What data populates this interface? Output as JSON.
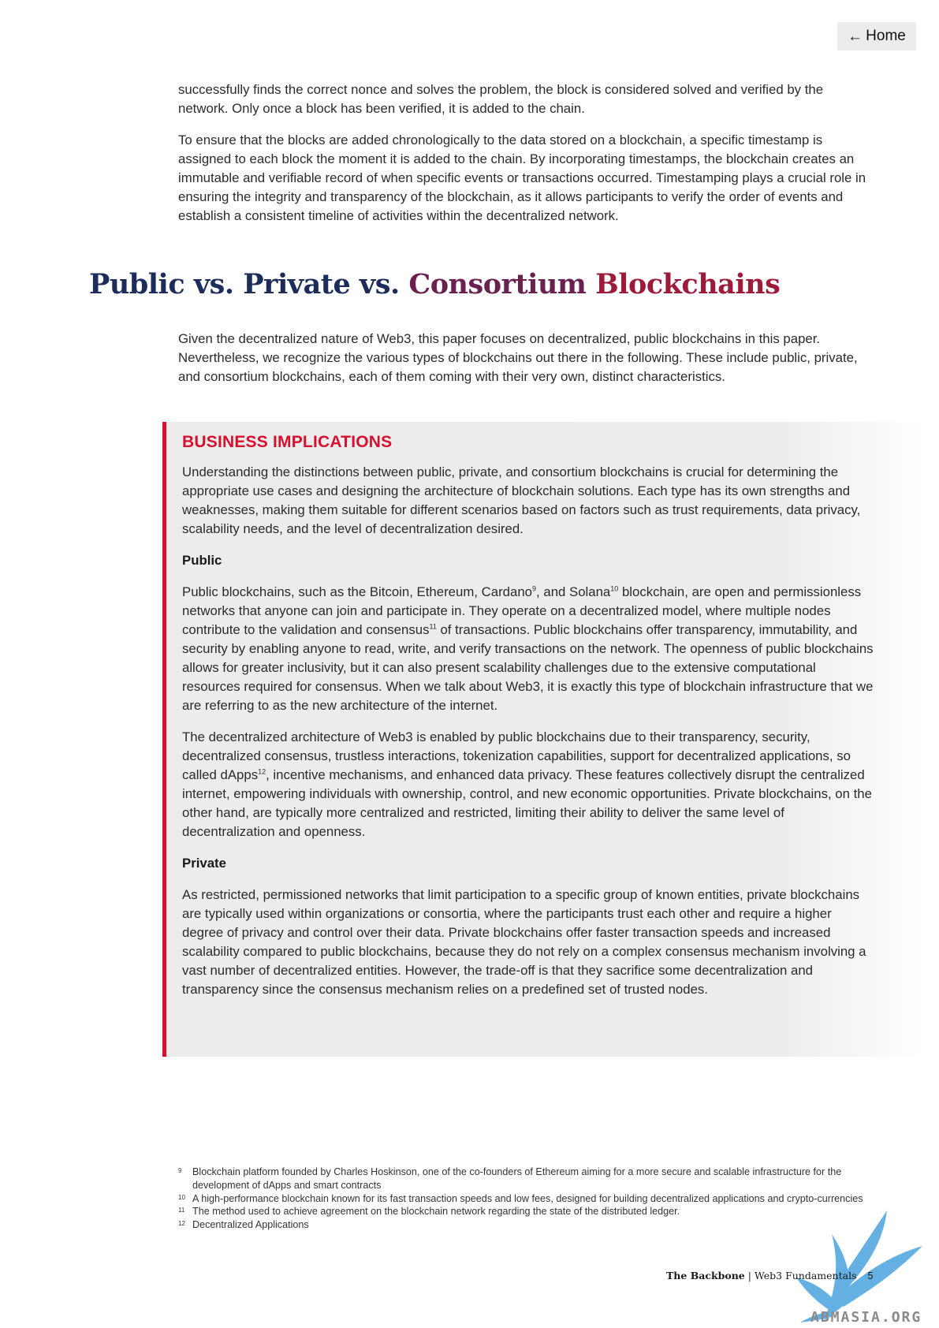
{
  "nav": {
    "home_label": "Home"
  },
  "intro": {
    "p1": "successfully finds the correct nonce and solves the problem, the block is considered solved and verified by the network. Only once a block has been verified, it is added to the chain.",
    "p2": "To ensure that the blocks are added chronologically to the data stored on a blockchain, a specific timestamp is assigned to each block the moment it is added to the chain. By incorporating timestamps, the blockchain creates an immutable and verifiable record of when specific events or transactions occurred. Timestamping plays a crucial role in ensuring the integrity and transparency of the blockchain, as it allows participants to verify the order of events and establish a consistent timeline of activities within the decentralized network."
  },
  "section": {
    "title_part1": "Public vs. Private vs. ",
    "title_part2": "Consortium ",
    "title_part3": "Blockchains",
    "paragraph": "Given the decentralized nature of Web3, this paper focuses on decentralized, public blockchains in this paper. Nevertheless, we recognize the various types of blockchains out there in the following. These include public, private, and consortium blockchains, each of them coming with their very own, distinct characteristics."
  },
  "callout": {
    "title": "BUSINESS IMPLICATIONS",
    "intro": "Understanding the distinctions between public, private, and consortium blockchains is crucial for determining the appropriate use cases and designing the architecture of blockchain solutions. Each type has its own strengths and weaknesses, making them suitable for different scenarios based on factors such as trust requirements, data privacy, scalability needs, and the level of decentralization desired.",
    "public_heading": "Public",
    "public_p1_a": "Public blockchains, such as the Bitcoin, Ethereum, Cardano",
    "public_p1_sup1": "9",
    "public_p1_b": ", and Solana",
    "public_p1_sup2": "10",
    "public_p1_c": " blockchain, are open and permissionless networks that anyone can join and participate in. They operate on a decentralized model, where multiple nodes contribute to the validation and consensus",
    "public_p1_sup3": "11",
    "public_p1_d": " of transactions. Public blockchains offer transparency, immutability, and security by enabling anyone to read, write, and verify transactions on the network. The openness of public blockchains allows for greater inclusivity, but it can also present scalability challenges due to the extensive computational resources required for consensus. When we talk about Web3, it is exactly this type of blockchain infrastructure that we are referring to as the new architecture of the internet.",
    "public_p2_a": "The decentralized architecture of Web3 is enabled by public blockchains due to their transparency, security, decentralized consensus, trustless interactions, tokenization capabilities, support for decentralized applications, so called dApps",
    "public_p2_sup": "12",
    "public_p2_b": ", incentive mechanisms, and enhanced data privacy. These features collectively disrupt the centralized internet, empowering individuals with ownership, control, and new economic opportunities. Private blockchains, on the other hand, are typically more centralized and restricted, limiting their ability to deliver the same level of decentralization and openness.",
    "private_heading": "Private",
    "private_p": "As restricted, permissioned networks that limit participation to a specific group of known entities, private blockchains are typically used within organizations or consortia, where the participants trust each other and require a higher degree of privacy and control over their data. Private blockchains offer faster transaction speeds and increased scalability compared to public blockchains, because they do not rely on a complex consensus mechanism involving a vast number of decentralized entities. However, the trade-off is that they sacrifice some decentralization and transparency since the consensus mechanism relies on a predefined set of trusted nodes."
  },
  "footnotes": [
    {
      "num": "9",
      "text": "Blockchain platform founded by Charles Hoskinson, one of the co-founders of Ethereum aiming for a more secure and scalable infrastructure for the development of dApps and smart contracts"
    },
    {
      "num": "10",
      "text": "A high-performance blockchain known for its fast transaction speeds and low fees, designed for building decentralized applications and crypto-currencies"
    },
    {
      "num": "11",
      "text": "The method used to achieve agreement on the blockchain network regarding the state of the distributed ledger."
    },
    {
      "num": "12",
      "text": "Decentralized Applications"
    }
  ],
  "footer": {
    "brand": "The Backbone",
    "separator": " | ",
    "doc": "Web3 Fundamentals",
    "page": "5"
  },
  "watermark": {
    "text": "ABMASIA.ORG",
    "icon": "bird-watermark-icon",
    "color": "#4aa3df"
  },
  "colors": {
    "accent_red": "#d8102e",
    "title_navy": "#1c2c5b",
    "title_plum": "#6b2150",
    "title_crimson": "#9d1a3b"
  }
}
